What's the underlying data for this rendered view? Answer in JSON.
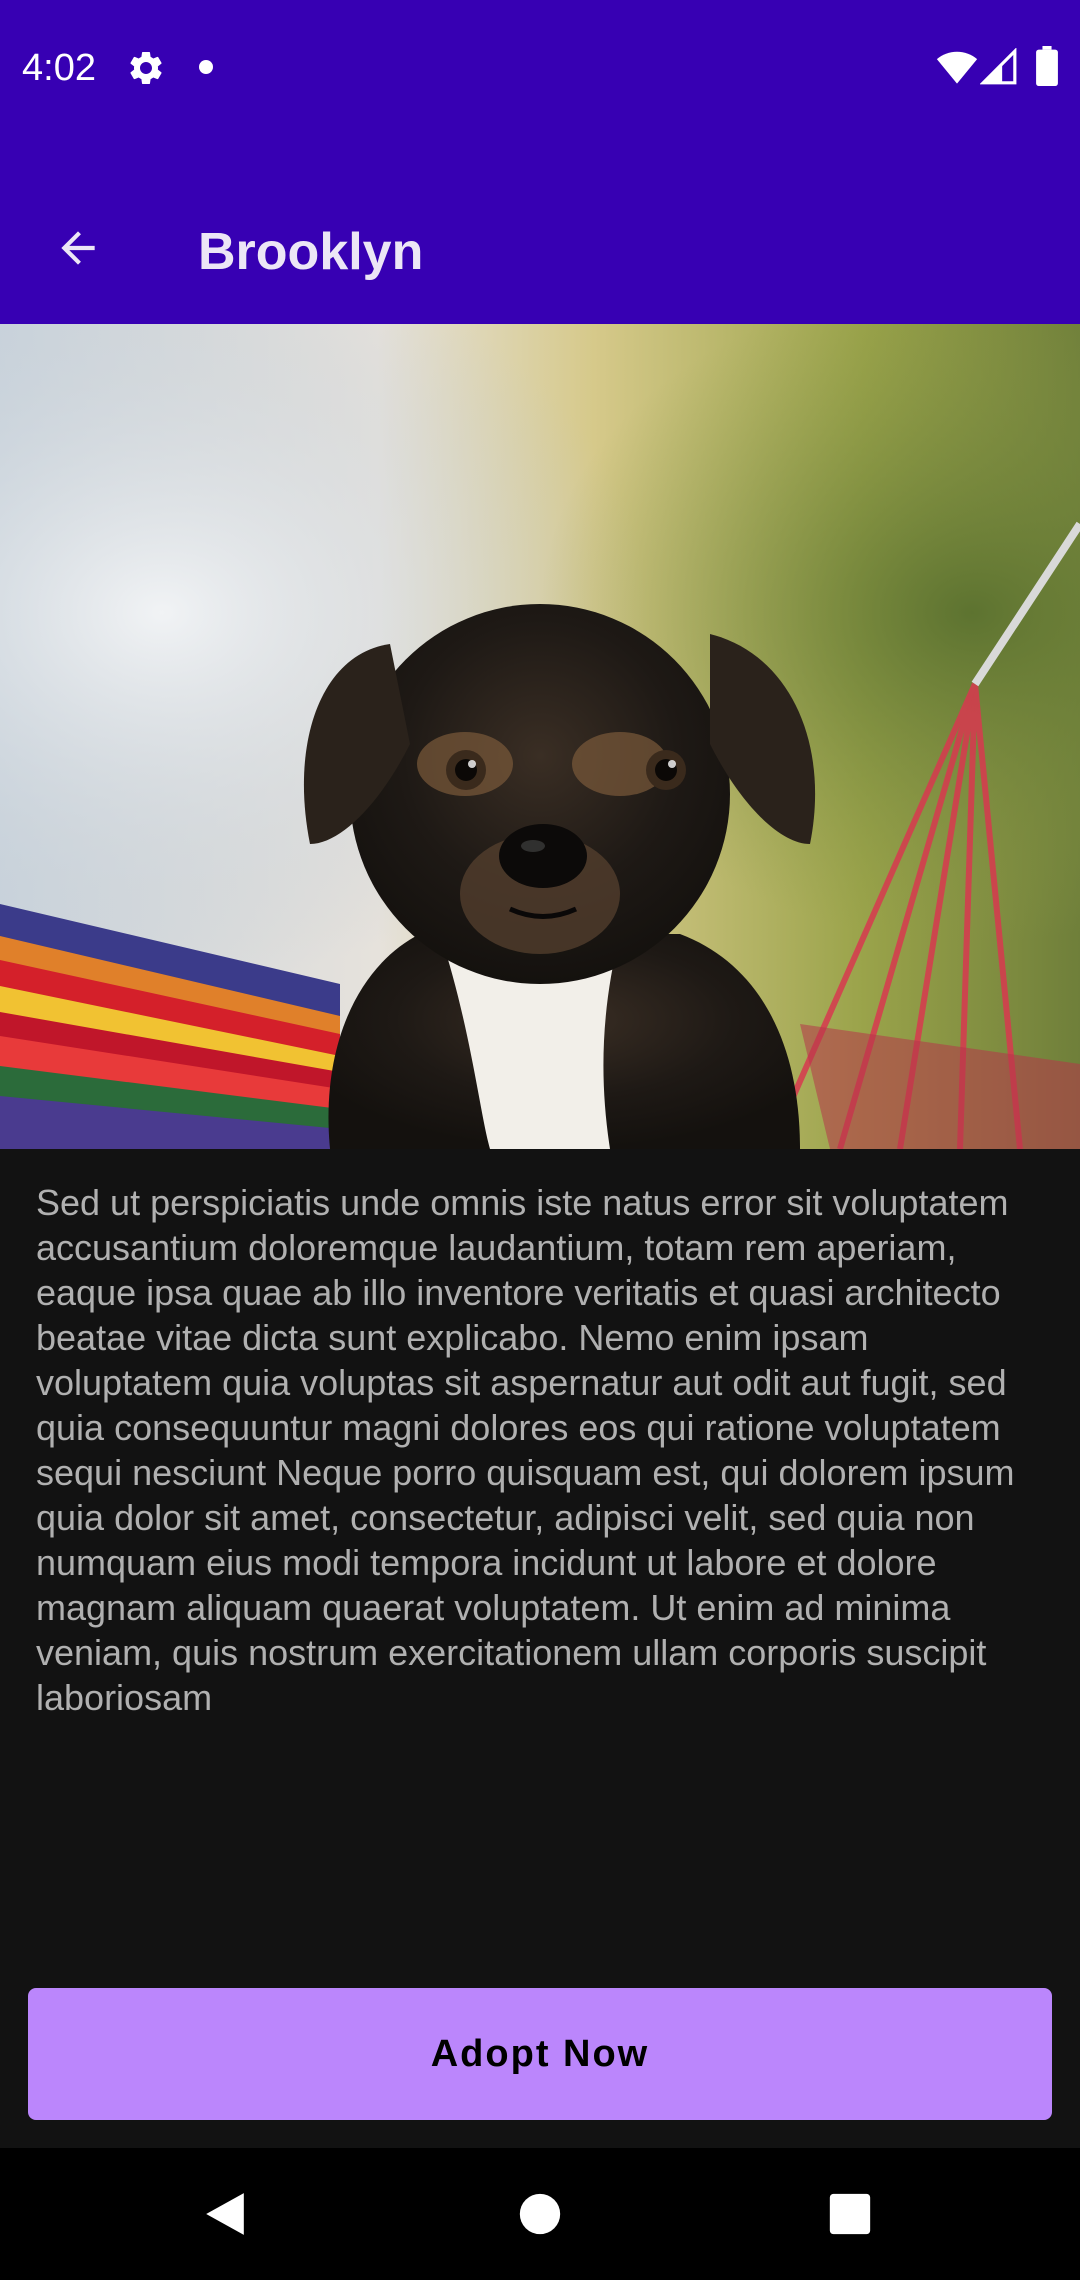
{
  "status_bar": {
    "time": "4:02",
    "icons": [
      "settings-icon",
      "notification-dot-icon",
      "wifi-icon",
      "signal-icon",
      "battery-icon"
    ],
    "background": "#3700B3"
  },
  "app_bar": {
    "title": "Brooklyn",
    "back_icon": "arrow-back-icon",
    "background": "#3700B3"
  },
  "hero_image": {
    "subject": "puppy photo"
  },
  "description": "Sed ut perspiciatis unde omnis iste natus error sit voluptatem accusantium doloremque laudantium, totam rem aperiam, eaque ipsa quae ab illo inventore veritatis et quasi architecto beatae vitae dicta sunt explicabo. Nemo enim ipsam voluptatem quia voluptas sit aspernatur aut odit aut fugit, sed quia consequuntur magni dolores eos qui ratione voluptatem sequi nesciunt Neque porro quisquam est, qui dolorem ipsum quia dolor sit amet, consectetur, adipisci velit, sed quia non numquam eius modi tempora incidunt ut labore et dolore magnam aliquam quaerat voluptatem. Ut enim ad minima veniam, quis nostrum exercitationem ullam corporis suscipit laboriosam",
  "adopt_button": {
    "label": "Adopt Now",
    "background": "#BB86FC"
  },
  "nav_bar": {
    "icons": [
      "nav-back-icon",
      "nav-home-icon",
      "nav-recents-icon"
    ]
  }
}
